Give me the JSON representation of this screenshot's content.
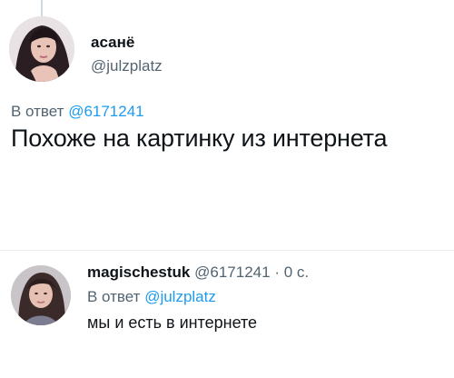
{
  "main_tweet": {
    "display_name": "асанё",
    "handle": "@julzplatz",
    "reply_prefix": "В ответ",
    "reply_to": "@6171241",
    "text": "Похоже на картинку из интернета",
    "avatar_icon": "profile-photo"
  },
  "reply_tweet": {
    "display_name": "magischestuk",
    "handle": "@6171241",
    "separator": "·",
    "time": "0 с.",
    "reply_prefix": "В ответ",
    "reply_to": "@julzplatz",
    "text": "мы и есть в интернете",
    "avatar_icon": "profile-photo"
  },
  "colors": {
    "text": "#0f1419",
    "muted": "#536471",
    "link": "#1d9bf0",
    "divider": "#e6ecf0"
  }
}
